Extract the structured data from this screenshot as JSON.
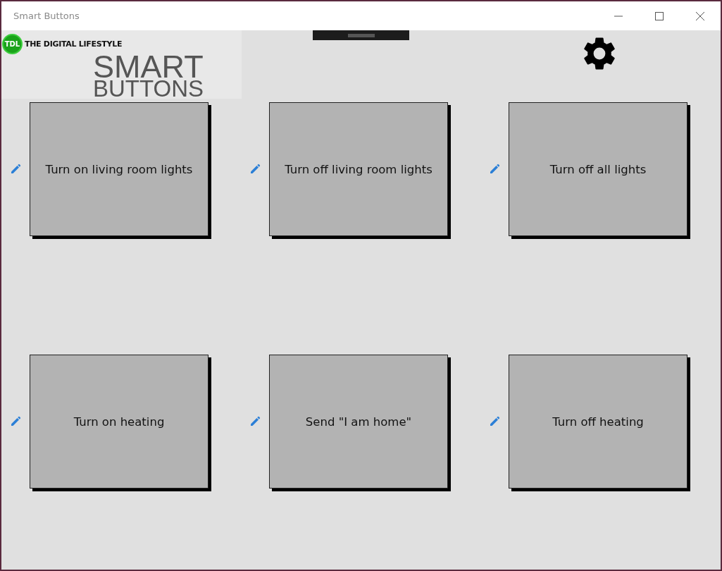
{
  "window": {
    "title": "Smart Buttons"
  },
  "logo": {
    "badge": "TDL",
    "brand": "THE DIGITAL LIFESTYLE",
    "title_line_1": "SMART",
    "title_line_2": "BUTTONS"
  },
  "buttons": [
    {
      "label": "Turn on living room lights"
    },
    {
      "label": "Turn off living room lights"
    },
    {
      "label": "Turn off all lights"
    },
    {
      "label": "Turn on heating"
    },
    {
      "label": "Send \"I am home\""
    },
    {
      "label": "Turn off heating"
    }
  ]
}
